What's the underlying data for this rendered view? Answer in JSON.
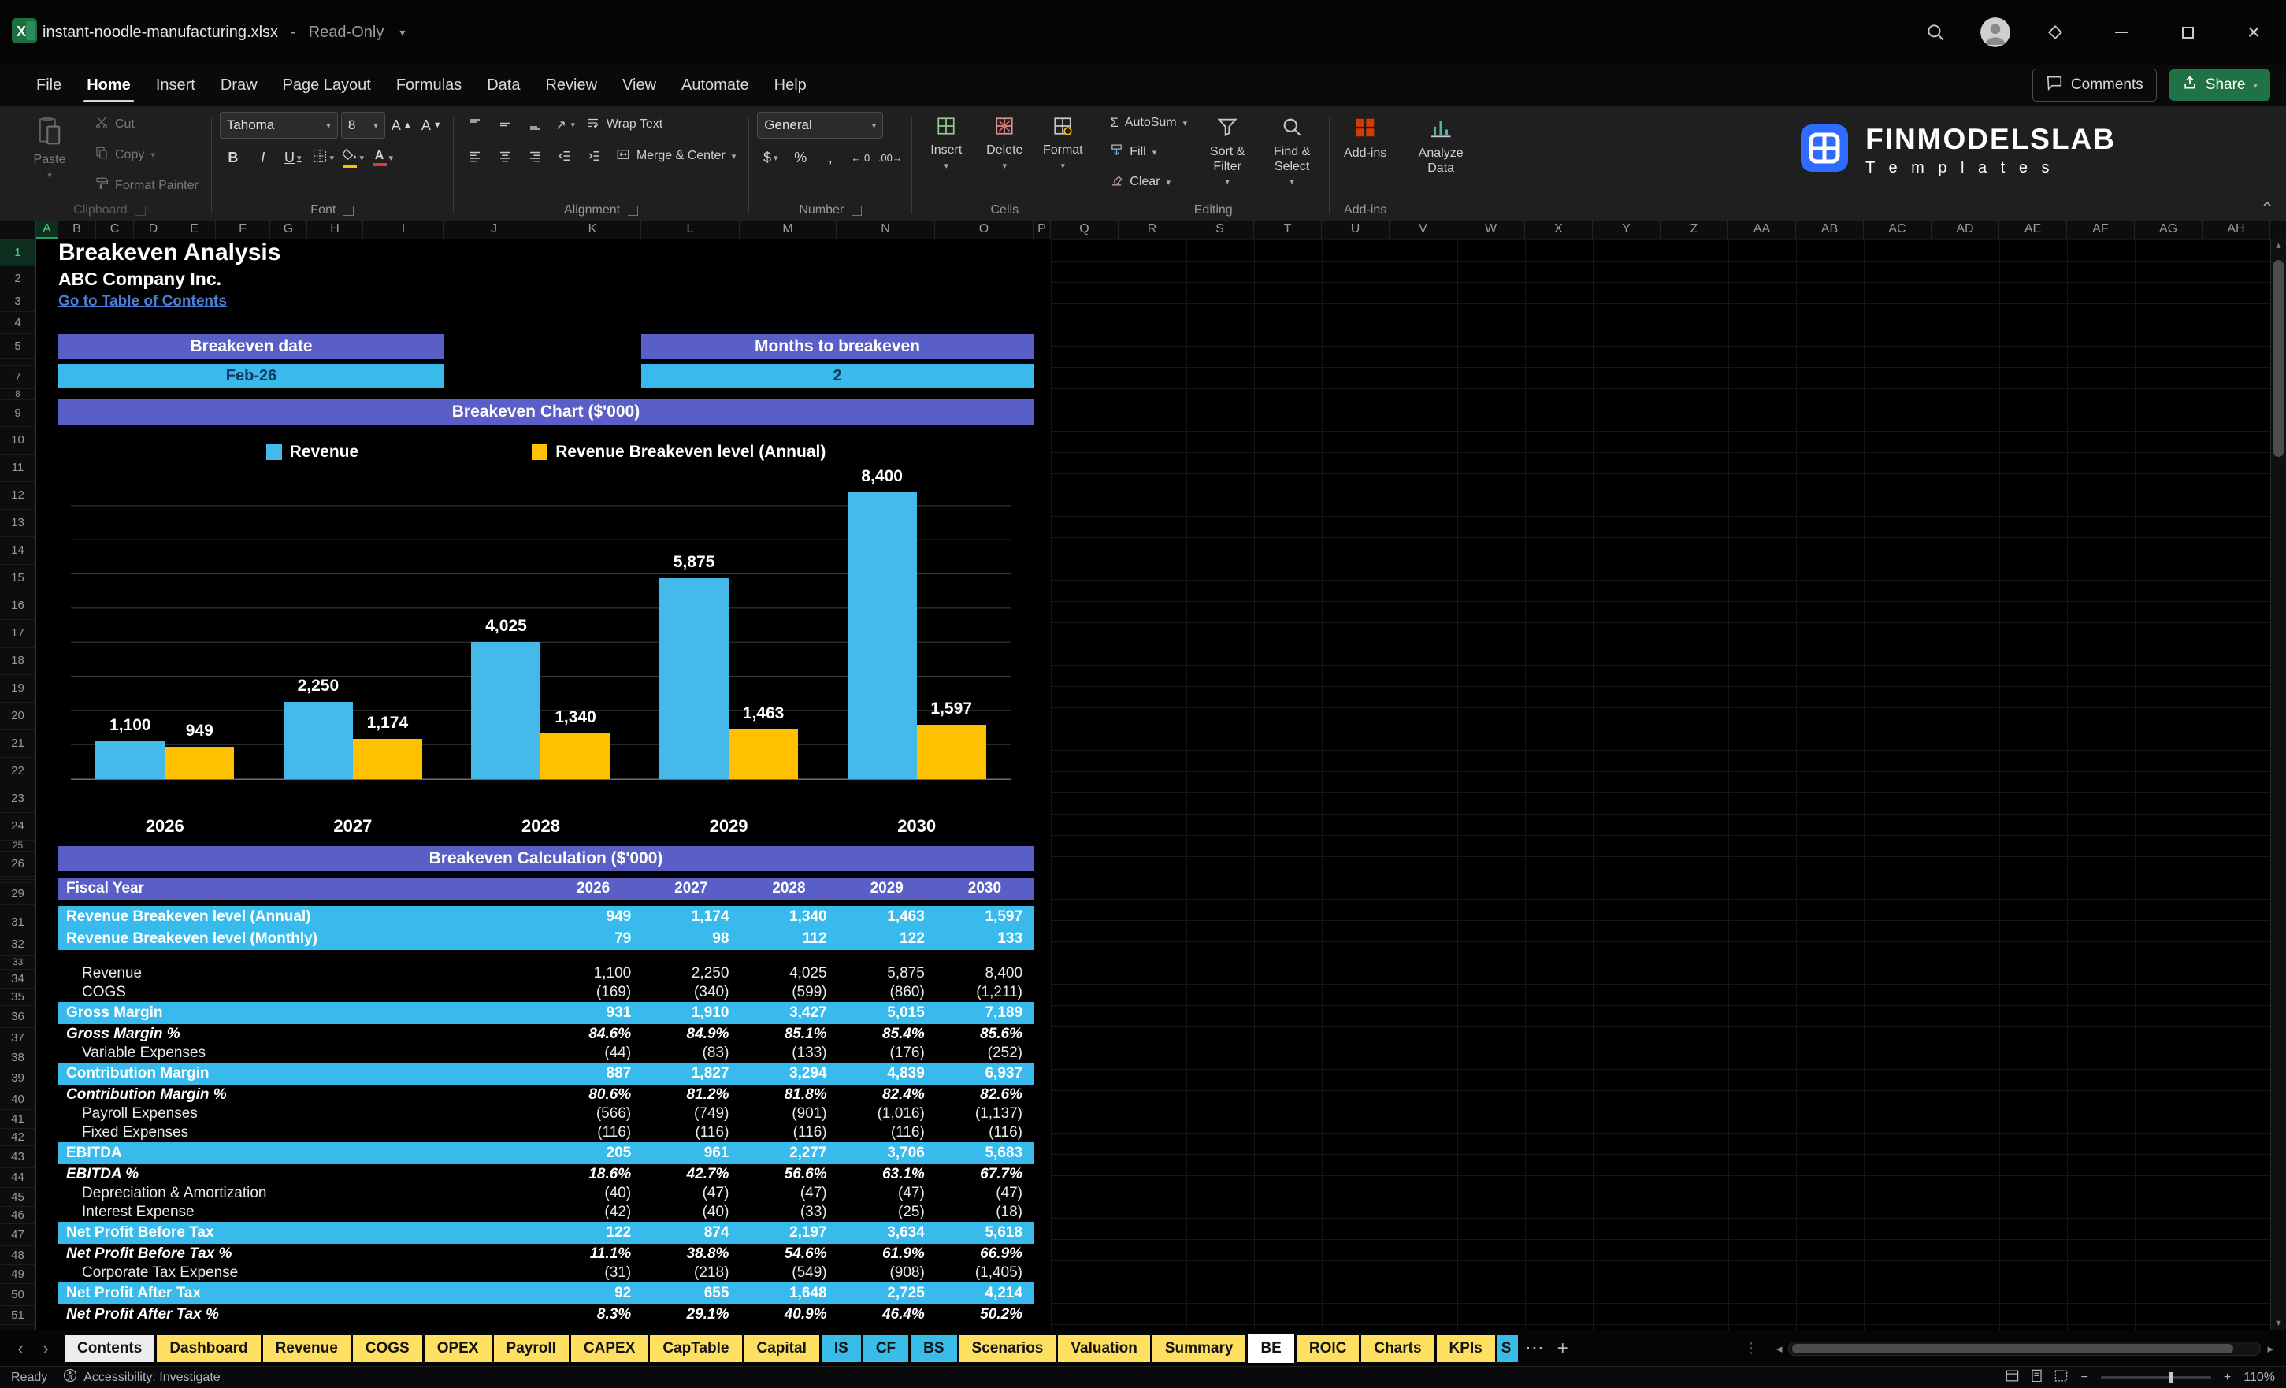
{
  "window": {
    "title": "instant-noodle-manufacturing.xlsx",
    "separator": "-",
    "mode": "Read-Only",
    "brand": {
      "name": "FINMODELSLAB",
      "tagline": "T e m p l a t e s"
    }
  },
  "menu": {
    "items": [
      "File",
      "Home",
      "Insert",
      "Draw",
      "Page Layout",
      "Formulas",
      "Data",
      "Review",
      "View",
      "Automate",
      "Help"
    ],
    "active": "Home",
    "comments": "Comments",
    "share": "Share"
  },
  "ribbon": {
    "groups": [
      "Clipboard",
      "Font",
      "Alignment",
      "Number",
      "Cells",
      "Editing",
      "Add-ins"
    ],
    "clipboard": {
      "paste": "Paste",
      "cut": "Cut",
      "copy": "Copy",
      "format_painter": "Format Painter"
    },
    "font": {
      "name": "Tahoma",
      "size": "8"
    },
    "glyphs": {
      "bold": "B",
      "italic": "I",
      "underline": "U",
      "currency": "$",
      "percent": "%",
      "comma": ",",
      "sigma": "Σ",
      "dec_increase": "←.0",
      "dec_decrease": ".00→"
    },
    "alignment": {
      "wrap": "Wrap Text",
      "merge": "Merge & Center"
    },
    "number": {
      "format": "General"
    },
    "cells": {
      "insert": "Insert",
      "delete": "Delete",
      "format": "Format"
    },
    "editing": {
      "autosum": "AutoSum",
      "fill": "Fill",
      "clear": "Clear",
      "sort": "Sort & Filter",
      "find": "Find & Select"
    },
    "addins": {
      "addins": "Add-ins",
      "analyze": "Analyze Data"
    }
  },
  "grid": {
    "columns": [
      "A",
      "B",
      "C",
      "D",
      "E",
      "F",
      "G",
      "H",
      "I",
      "J",
      "K",
      "L",
      "M",
      "N",
      "O",
      "P",
      "Q",
      "R",
      "S",
      "T",
      "U",
      "V",
      "W",
      "X",
      "Y",
      "Z",
      "AA",
      "AB",
      "AC",
      "AD",
      "AE",
      "AF",
      "AG",
      "AH"
    ],
    "first_row": 1,
    "last_row": 51
  },
  "content": {
    "title": "Breakeven Analysis",
    "company": "ABC Company Inc.",
    "toc": "Go to Table of Contents",
    "cards": [
      {
        "label": "Breakeven date",
        "value": "Feb-26"
      },
      {
        "label": "Months to breakeven",
        "value": "2"
      }
    ]
  },
  "chart_data": {
    "type": "bar",
    "title": "Breakeven Chart ($'000)",
    "categories": [
      "2026",
      "2027",
      "2028",
      "2029",
      "2030"
    ],
    "series": [
      {
        "name": "Revenue",
        "color": "#45b9e9",
        "values": [
          1100,
          2250,
          4025,
          5875,
          8400
        ],
        "labels": [
          "1,100",
          "2,250",
          "4,025",
          "5,875",
          "8,400"
        ]
      },
      {
        "name": "Revenue Breakeven level (Annual)",
        "color": "#ffc000",
        "values": [
          949,
          1174,
          1340,
          1463,
          1597
        ],
        "labels": [
          "949",
          "1,174",
          "1,340",
          "1,463",
          "1,597"
        ]
      }
    ],
    "ylim": [
      0,
      9000
    ],
    "gridlines": true,
    "legend_position": "top"
  },
  "calc_table": {
    "title": "Breakeven Calculation ($'000)",
    "columns": [
      "Fiscal Year",
      "2026",
      "2027",
      "2028",
      "2029",
      "2030"
    ],
    "rows": [
      {
        "label": "Revenue Breakeven level (Annual)",
        "style": "band",
        "values": [
          "949",
          "1,174",
          "1,340",
          "1,463",
          "1,597"
        ]
      },
      {
        "label": "Revenue Breakeven level (Monthly)",
        "style": "band",
        "values": [
          "79",
          "98",
          "112",
          "122",
          "133"
        ]
      },
      {
        "label": "",
        "style": "gap",
        "values": []
      },
      {
        "label": "Revenue",
        "style": "plain",
        "values": [
          "1,100",
          "2,250",
          "4,025",
          "5,875",
          "8,400"
        ]
      },
      {
        "label": "COGS",
        "style": "plain",
        "values": [
          "(169)",
          "(340)",
          "(599)",
          "(860)",
          "(1,211)"
        ]
      },
      {
        "label": "Gross Margin",
        "style": "band",
        "values": [
          "931",
          "1,910",
          "3,427",
          "5,015",
          "7,189"
        ]
      },
      {
        "label": "Gross Margin %",
        "style": "pct",
        "values": [
          "84.6%",
          "84.9%",
          "85.1%",
          "85.4%",
          "85.6%"
        ]
      },
      {
        "label": "Variable Expenses",
        "style": "plain",
        "values": [
          "(44)",
          "(83)",
          "(133)",
          "(176)",
          "(252)"
        ]
      },
      {
        "label": "Contribution Margin",
        "style": "band",
        "values": [
          "887",
          "1,827",
          "3,294",
          "4,839",
          "6,937"
        ]
      },
      {
        "label": "Contribution Margin %",
        "style": "pct",
        "values": [
          "80.6%",
          "81.2%",
          "81.8%",
          "82.4%",
          "82.6%"
        ]
      },
      {
        "label": "Payroll Expenses",
        "style": "plain",
        "values": [
          "(566)",
          "(749)",
          "(901)",
          "(1,016)",
          "(1,137)"
        ]
      },
      {
        "label": "Fixed Expenses",
        "style": "plain",
        "values": [
          "(116)",
          "(116)",
          "(116)",
          "(116)",
          "(116)"
        ]
      },
      {
        "label": "EBITDA",
        "style": "band",
        "values": [
          "205",
          "961",
          "2,277",
          "3,706",
          "5,683"
        ]
      },
      {
        "label": "EBITDA %",
        "style": "pct",
        "values": [
          "18.6%",
          "42.7%",
          "56.6%",
          "63.1%",
          "67.7%"
        ]
      },
      {
        "label": "Depreciation & Amortization",
        "style": "plain",
        "values": [
          "(40)",
          "(47)",
          "(47)",
          "(47)",
          "(47)"
        ]
      },
      {
        "label": "Interest Expense",
        "style": "plain",
        "values": [
          "(42)",
          "(40)",
          "(33)",
          "(25)",
          "(18)"
        ]
      },
      {
        "label": "Net Profit Before Tax",
        "style": "band",
        "values": [
          "122",
          "874",
          "2,197",
          "3,634",
          "5,618"
        ]
      },
      {
        "label": "Net Profit Before Tax %",
        "style": "pct",
        "values": [
          "11.1%",
          "38.8%",
          "54.6%",
          "61.9%",
          "66.9%"
        ]
      },
      {
        "label": "Corporate Tax Expense",
        "style": "plain",
        "values": [
          "(31)",
          "(218)",
          "(549)",
          "(908)",
          "(1,405)"
        ]
      },
      {
        "label": "Net Profit After Tax",
        "style": "band",
        "values": [
          "92",
          "655",
          "1,648",
          "2,725",
          "4,214"
        ]
      },
      {
        "label": "Net Profit After Tax %",
        "style": "pct",
        "values": [
          "8.3%",
          "29.1%",
          "40.9%",
          "46.4%",
          "50.2%"
        ]
      }
    ]
  },
  "tabs": {
    "items": [
      {
        "label": "Contents",
        "color": "gray"
      },
      {
        "label": "Dashboard",
        "color": "yellow"
      },
      {
        "label": "Revenue",
        "color": "yellow"
      },
      {
        "label": "COGS",
        "color": "yellow"
      },
      {
        "label": "OPEX",
        "color": "yellow"
      },
      {
        "label": "Payroll",
        "color": "yellow"
      },
      {
        "label": "CAPEX",
        "color": "yellow"
      },
      {
        "label": "CapTable",
        "color": "yellow"
      },
      {
        "label": "Capital",
        "color": "yellow"
      },
      {
        "label": "IS",
        "color": "blue"
      },
      {
        "label": "CF",
        "color": "blue"
      },
      {
        "label": "BS",
        "color": "blue"
      },
      {
        "label": "Scenarios",
        "color": "yellow"
      },
      {
        "label": "Valuation",
        "color": "yellow"
      },
      {
        "label": "Summary",
        "color": "yellow"
      },
      {
        "label": "BE",
        "color": "white",
        "active": true
      },
      {
        "label": "ROIC",
        "color": "yellow"
      },
      {
        "label": "Charts",
        "color": "yellow"
      },
      {
        "label": "KPIs",
        "color": "yellow"
      },
      {
        "label": "S",
        "color": "blue",
        "clipped": true
      }
    ],
    "overflow": "⋯",
    "add": "+"
  },
  "status": {
    "ready": "Ready",
    "accessibility": "Accessibility: Investigate",
    "zoom_out": "−",
    "zoom_in": "+",
    "zoom": "110%"
  },
  "colors": {
    "purple": "#5a5fc7",
    "cyan": "#38bbec",
    "chart_blue": "#45b9e9",
    "chart_yellow": "#ffc000",
    "tab_yellow": "#ffdf60",
    "tab_blue": "#38bde9",
    "link": "#4a7fd6",
    "share_green": "#1f7244"
  }
}
